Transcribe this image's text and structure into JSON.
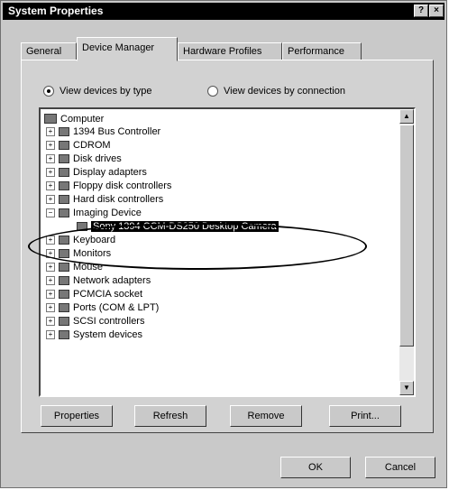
{
  "window": {
    "title": "System Properties"
  },
  "titlebar_buttons": {
    "help": "?",
    "close": "×"
  },
  "tabs": [
    {
      "label": "General"
    },
    {
      "label": "Device Manager"
    },
    {
      "label": "Hardware Profiles"
    },
    {
      "label": "Performance"
    }
  ],
  "view_options": {
    "by_type": "View devices by type",
    "by_connection": "View devices by connection",
    "selected": "by_type"
  },
  "tree": [
    {
      "label": "Computer",
      "icon": "computer-icon"
    },
    {
      "label": "1394 Bus Controller",
      "icon": "bus-controller-icon"
    },
    {
      "label": "CDROM",
      "icon": "cdrom-icon"
    },
    {
      "label": "Disk drives",
      "icon": "disk-drive-icon"
    },
    {
      "label": "Display adapters",
      "icon": "display-adapter-icon"
    },
    {
      "label": "Floppy disk controllers",
      "icon": "floppy-controller-icon"
    },
    {
      "label": "Hard disk controllers",
      "icon": "hard-disk-controller-icon"
    },
    {
      "label": "Imaging Device",
      "icon": "imaging-device-icon"
    },
    {
      "label": "Sony 1394 CCM-DS250 Desktop Camera",
      "icon": "camera-icon",
      "selected": true
    },
    {
      "label": "Keyboard",
      "icon": "keyboard-icon"
    },
    {
      "label": "Monitors",
      "icon": "monitor-icon"
    },
    {
      "label": "Mouse",
      "icon": "mouse-icon"
    },
    {
      "label": "Network adapters",
      "icon": "network-adapter-icon"
    },
    {
      "label": "PCMCIA socket",
      "icon": "pcmcia-icon"
    },
    {
      "label": "Ports (COM & LPT)",
      "icon": "port-icon"
    },
    {
      "label": "SCSI controllers",
      "icon": "scsi-controller-icon"
    },
    {
      "label": "System devices",
      "icon": "system-device-icon"
    }
  ],
  "buttons": {
    "properties": "Properties",
    "refresh": "Refresh",
    "remove": "Remove",
    "print": "Print..."
  },
  "dialog": {
    "ok": "OK",
    "cancel": "Cancel"
  }
}
